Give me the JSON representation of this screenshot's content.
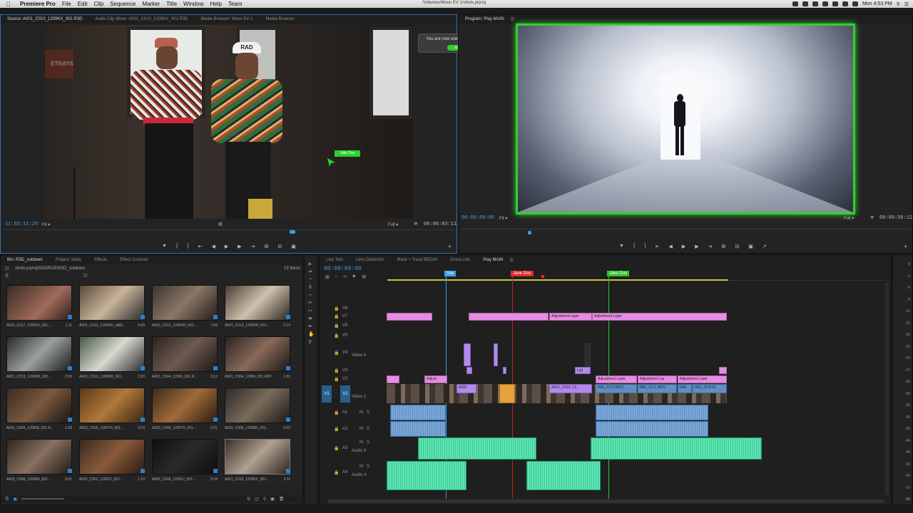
{
  "menubar": {
    "app": "Premiere Pro",
    "items": [
      "File",
      "Edit",
      "Clip",
      "Sequence",
      "Marker",
      "Title",
      "Window",
      "Help",
      "Team"
    ],
    "path": "/Volumes/Moon EV 1/shots.prproj",
    "clock": "Mon 4:53 PM"
  },
  "source_monitor": {
    "tabs": [
      "Source: A001_C010_1209KX_001.R3D",
      "Audio Clip Mixer: A001_C010_1209KX_001.R3D",
      "Media Browser: Moon EV 1",
      "Media Browser"
    ],
    "timecode": "11:53:11:20",
    "zoom": "Fit",
    "quality": "Full",
    "duration": "00:00:03:11",
    "cap_text": "RAD",
    "sign_text": "ETRAYS",
    "cursor_label": "Jake Doe"
  },
  "notification": {
    "message": "You are now watching Jake Doe",
    "exit_label": "Exit"
  },
  "program_monitor": {
    "tab": "Program: Play MAIN",
    "timecode": "00:00:09:00",
    "zoom": "Fit",
    "quality": "Full",
    "duration": "00:00:56:12"
  },
  "bin": {
    "tabs": [
      "Bin: R3D_cutdown",
      "Project: shots",
      "Effects",
      "Effect Controls"
    ],
    "path": "shots.prproj\\SOURCE\\R3D_cutdown",
    "count": "19 Items",
    "items": [
      {
        "name": "A003_C017_1209SX_001...",
        "dur": "1:11"
      },
      {
        "name": "A001_C013_1209DH_still0...",
        "dur": "5:00"
      },
      {
        "name": "A001_C013_1209DH_001...",
        "dur": "7:09"
      },
      {
        "name": "A001_C013_1209DH_001...",
        "dur": "2:14"
      },
      {
        "name": "A001_C013_1209DH_001...",
        "dur": "2:05"
      },
      {
        "name": "A001_C013_1209DH_001...",
        "dur": "2:20"
      },
      {
        "name": "A001_C004_12096_001.R...",
        "dur": "3:12"
      },
      {
        "name": "A001_C004_12096_001.R3D",
        "dur": "1:01"
      },
      {
        "name": "A001_C004_120908_001.R...",
        "dur": "1:09"
      },
      {
        "name": "A003_C006_12097N_001...",
        "dur": "0:03"
      },
      {
        "name": "A003_C006_12097N_001...",
        "dur": "0:21"
      },
      {
        "name": "A003_C008_12099N_001...",
        "dur": "0:03"
      },
      {
        "name": "A003_C008_12099N_001...",
        "dur": "0:01"
      },
      {
        "name": "A003_C001_12093J_001...",
        "dur": "1:10"
      },
      {
        "name": "A002_C008_120912_001...",
        "dur": "0:18"
      },
      {
        "name": "A001_C010_1209KX_001...",
        "dur": "3:11"
      }
    ]
  },
  "timeline": {
    "tabs": [
      "Live Text",
      "Lens Distortion",
      "Mask + Track BEGIN",
      "Direct Link",
      "Play MAIN"
    ],
    "timecode": "00:00:09:00",
    "markers": [
      {
        "label": "You",
        "color": "#3aa0e8"
      },
      {
        "label": "Jane Doe",
        "color": "#e02828"
      },
      {
        "label": "Jake Doe",
        "color": "#2cc42c"
      }
    ],
    "tracks": {
      "v8": "V8",
      "v7": "V7",
      "v6": "V6",
      "v5": "V5",
      "v4": "V4",
      "v4name": "Video 4",
      "v3": "V3",
      "v2": "V2",
      "v1": "V1",
      "v1name": "Video 1",
      "v1src": "V1",
      "a1": "A1",
      "a2": "A2",
      "a3": "A3",
      "a3name": "Audio 3",
      "a4": "A4",
      "a4name": "Audio 4",
      "m": "M",
      "s": "S"
    },
    "clip_labels": {
      "adj1": "Adjustment Layer",
      "adj2": "Adjustment Layer",
      "adjust": "Adjust",
      "light": "Ligt",
      "adj3": "Adjustment Layer",
      "adj4": "Adjustment Lay",
      "adj5": "Adjustment Layer",
      "a002": "A002",
      "a001": "A001_C013_12...",
      "img1": "IMG_3173.MOV",
      "img2": "IMG_3171.MOV",
      "img3": "IMG_3175.M",
      "img_short": "IMG"
    },
    "meter": [
      "0",
      "-3",
      "-6",
      "-9",
      "-12",
      "-15",
      "-18",
      "-21",
      "-24",
      "-27",
      "-30",
      "-33",
      "-36",
      "-39",
      "-42",
      "-45",
      "-48",
      "-51",
      "-54",
      "-57",
      "dB"
    ]
  },
  "colors": {
    "accent": "#3aa0e8",
    "jane": "#e02828",
    "jake": "#2cc42c",
    "pink_clip": "#e58de0",
    "violet_clip": "#b28ae8",
    "blue_clip": "#5f8fc2",
    "green_clip": "#44d6a0"
  }
}
